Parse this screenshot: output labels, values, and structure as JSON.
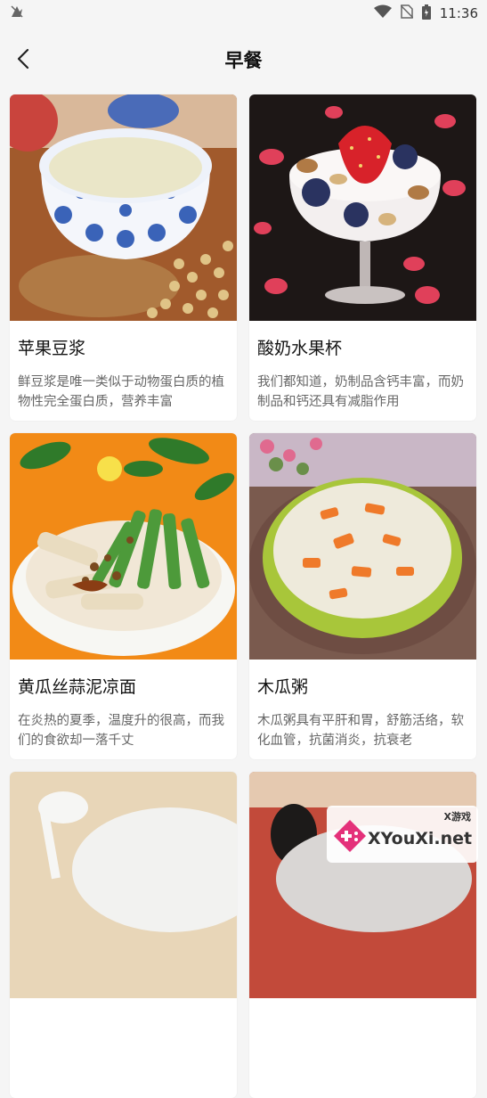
{
  "status_bar": {
    "time": "11:36"
  },
  "header": {
    "title": "早餐"
  },
  "cards": [
    {
      "title": "苹果豆浆",
      "desc": "鲜豆浆是唯一类似于动物蛋白质的植物性完全蛋白质，营养丰富",
      "image": "soy-milk-photo"
    },
    {
      "title": "酸奶水果杯",
      "desc": "我们都知道，奶制品含钙丰富，而奶制品和钙还具有减脂作用",
      "image": "yogurt-fruit-cup-photo"
    },
    {
      "title": "黄瓜丝蒜泥凉面",
      "desc": "在炎热的夏季，温度升的很高，而我们的食欲却一落千丈",
      "image": "cucumber-garlic-cold-noodles-photo"
    },
    {
      "title": "木瓜粥",
      "desc": "木瓜粥具有平肝和胃，舒筋活络，软化血管，抗菌消炎，抗衰老",
      "image": "papaya-congee-photo"
    }
  ],
  "watermark": {
    "small": "X游戏",
    "main": "XYouXi.net"
  }
}
